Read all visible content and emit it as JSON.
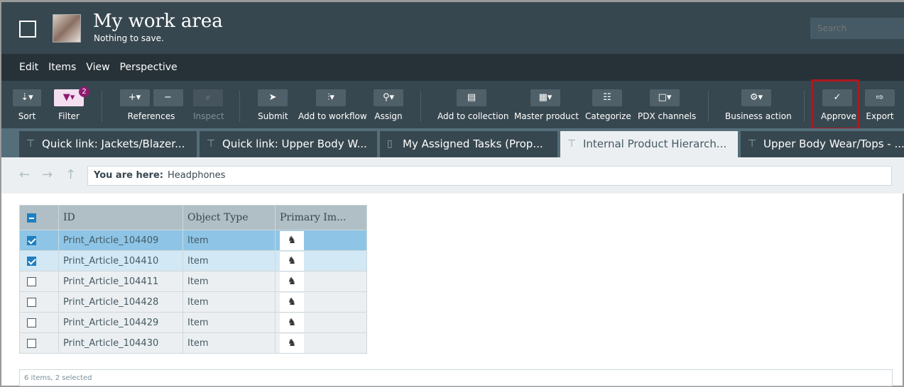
{
  "header": {
    "title": "My work area",
    "subtitle": "Nothing to save.",
    "search_placeholder": "Search"
  },
  "menu": [
    "Edit",
    "Items",
    "View",
    "Perspective"
  ],
  "toolbar": {
    "sort": "Sort",
    "filter": "Filter",
    "filter_badge": "2",
    "references": "References",
    "inspect": "Inspect",
    "submit": "Submit",
    "add_to_workflow": "Add to workflow",
    "assign": "Assign",
    "add_to_collection": "Add to collection",
    "master_product": "Master product",
    "categorize": "Categorize",
    "pdx_channels": "PDX channels",
    "business_action": "Business action",
    "approve": "Approve",
    "export": "Export"
  },
  "tabs": [
    "Quick link: Jackets/Blazer...",
    "Quick link: Upper Body W...",
    "My Assigned Tasks (Prop...",
    "Internal Product Hierarch...",
    "Upper Body Wear/Tops - ..."
  ],
  "breadcrumb": {
    "label": "You are here:",
    "value": "Headphones"
  },
  "table": {
    "columns": [
      "ID",
      "Object Type",
      "Primary Im..."
    ],
    "rows": [
      {
        "id": "Print_Article_104409",
        "type": "Item",
        "checked": true
      },
      {
        "id": "Print_Article_104410",
        "type": "Item",
        "checked": true
      },
      {
        "id": "Print_Article_104411",
        "type": "Item",
        "checked": false
      },
      {
        "id": "Print_Article_104428",
        "type": "Item",
        "checked": false
      },
      {
        "id": "Print_Article_104429",
        "type": "Item",
        "checked": false
      },
      {
        "id": "Print_Article_104430",
        "type": "Item",
        "checked": false
      }
    ]
  },
  "status": "6 items, 2 selected"
}
